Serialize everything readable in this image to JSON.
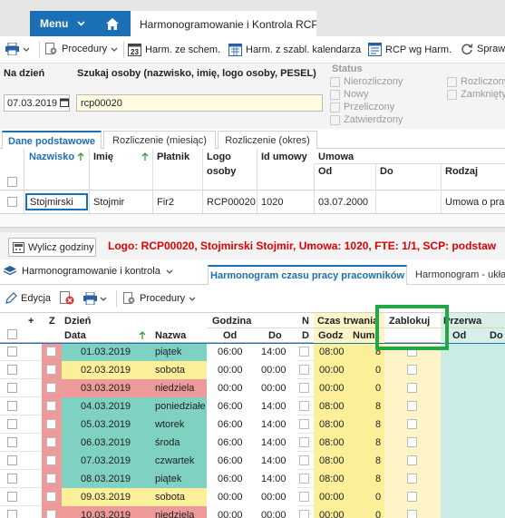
{
  "topbar": {
    "menu_label": "Menu",
    "app_tab": "Harmonogramowanie i Kontrola RCP"
  },
  "toolbar": {
    "procedury": "Procedury",
    "harm_schem": "Harm. ze schem.",
    "harm_kal": "Harm. z szabl. kalendarza",
    "rcp_harm": "RCP wg Harm.",
    "spraw": "Spraw"
  },
  "filter": {
    "na_dzien_label": "Na dzień",
    "na_dzien_value": "07.03.2019",
    "szukaj_label": "Szukaj osoby (nazwisko, imię, logo osoby, PESEL)",
    "szukaj_value": "rcp00020",
    "status_label": "Status",
    "statuses_left": [
      "Nierozliczony",
      "Nowy",
      "Przeliczony",
      "Zatwierdzony"
    ],
    "statuses_right": [
      "Rozliczony",
      "Zamknięty"
    ]
  },
  "tabs_top": [
    "Dane podstawowe",
    "Rozliczenie (miesiąc)",
    "Rozliczenie (okres)"
  ],
  "grid1": {
    "headers": {
      "nazwisko": "Nazwisko",
      "imie": "Imię",
      "platnik": "Płatnik",
      "logo1": "Logo",
      "logo2": "osoby",
      "id_umowy": "Id umowy",
      "umowa": "Umowa",
      "od": "Od",
      "do": "Do",
      "rodzaj": "Rodzaj"
    },
    "row": {
      "nazwisko": "Stojmirski",
      "imie": "Stojmir",
      "platnik": "Fir2",
      "logo": "RCP00020",
      "id_umowy": "1020",
      "od": "03.07.2000",
      "do": "",
      "rodzaj": "Umowa o prac"
    }
  },
  "action": {
    "wylicz": "Wylicz godziny",
    "info": "Logo: RCP00020, Stojmirski Stojmir, Umowa: 1020, FTE: 1/1, SCP: podstaw"
  },
  "lower": {
    "dropdown": "Harmonogramowanie i kontrola",
    "tab_active": "Harmonogram czasu pracy pracowników",
    "tab_other": "Harmonogram - ukła",
    "edycja": "Edycja",
    "procedury": "Procedury"
  },
  "grid2": {
    "h_plus": "+",
    "h_z": "Z",
    "h_dzien": "Dzień",
    "h_data": "Data",
    "h_nazwa": "Nazwa",
    "h_godzina": "Godzina",
    "h_od": "Od",
    "h_do": "Do",
    "h_n": "N",
    "h_d": "D",
    "h_czas": "Czas trwania",
    "h_godz": "Godz",
    "h_num": "Num",
    "h_zablokuj": "Zablokuj",
    "h_przerwa": "Przerwa",
    "h_pod": "Od",
    "h_pdo": "Do",
    "rows": [
      {
        "data": "01.03.2019",
        "nazwa": "piątek",
        "od": "06:00",
        "do": "14:00",
        "godz": "08:00",
        "num": "8",
        "color": "#7fd1c2"
      },
      {
        "data": "02.03.2019",
        "nazwa": "sobota",
        "od": "00:00",
        "do": "00:00",
        "godz": "00:00",
        "num": "0",
        "color": "#fbef9a"
      },
      {
        "data": "03.03.2019",
        "nazwa": "niedziela",
        "od": "00:00",
        "do": "00:00",
        "godz": "00:00",
        "num": "0",
        "color": "#ee9a9a"
      },
      {
        "data": "04.03.2019",
        "nazwa": "poniedziałe",
        "od": "06:00",
        "do": "14:00",
        "godz": "08:00",
        "num": "8",
        "color": "#7fd1c2"
      },
      {
        "data": "05.03.2019",
        "nazwa": "wtorek",
        "od": "06:00",
        "do": "14:00",
        "godz": "08:00",
        "num": "8",
        "color": "#7fd1c2"
      },
      {
        "data": "06.03.2019",
        "nazwa": "środa",
        "od": "06:00",
        "do": "14:00",
        "godz": "08:00",
        "num": "8",
        "color": "#7fd1c2"
      },
      {
        "data": "07.03.2019",
        "nazwa": "czwartek",
        "od": "06:00",
        "do": "14:00",
        "godz": "08:00",
        "num": "8",
        "color": "#7fd1c2"
      },
      {
        "data": "08.03.2019",
        "nazwa": "piątek",
        "od": "06:00",
        "do": "14:00",
        "godz": "08:00",
        "num": "8",
        "color": "#7fd1c2"
      },
      {
        "data": "09.03.2019",
        "nazwa": "sobota",
        "od": "00:00",
        "do": "00:00",
        "godz": "00:00",
        "num": "0",
        "color": "#fbef9a"
      },
      {
        "data": "10.03.2019",
        "nazwa": "niedziela",
        "od": "00:00",
        "do": "00:00",
        "godz": "00:00",
        "num": "0",
        "color": "#ee9a9a"
      }
    ]
  },
  "colors": {
    "accent": "#1a6fb5",
    "highlight": "#22a745",
    "info_text": "#e00000"
  }
}
